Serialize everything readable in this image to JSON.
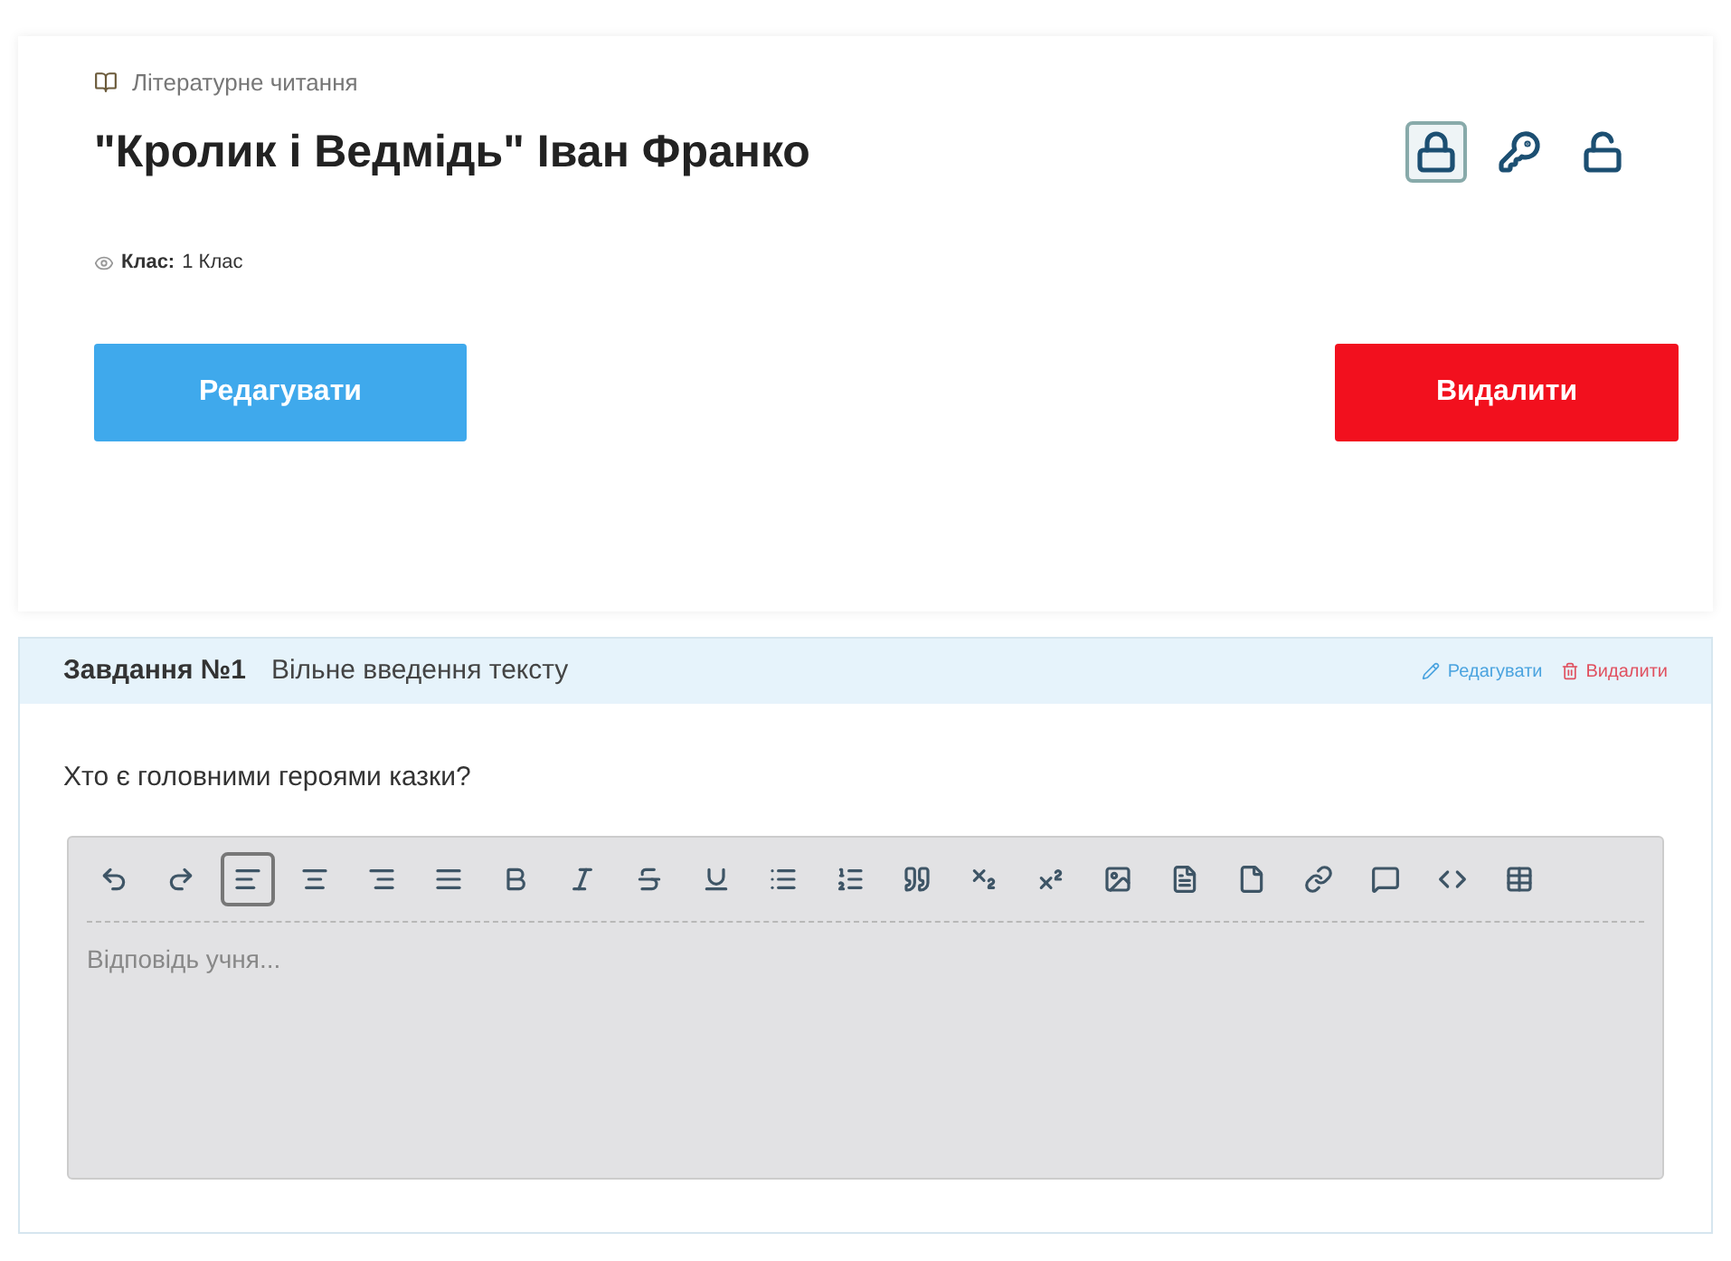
{
  "lesson": {
    "subject": "Літературне читання",
    "title": "\"Кролик і Ведмідь\" Іван Франко",
    "class_label": "Клас:",
    "class_value": "1 Клас"
  },
  "access_icons": [
    {
      "kind": "lock",
      "selected": true
    },
    {
      "kind": "key",
      "selected": false
    },
    {
      "kind": "unlock",
      "selected": false
    }
  ],
  "actions": {
    "edit": "Редагувати",
    "delete": "Видалити"
  },
  "task": {
    "number": "Завдання №1",
    "type": "Вільне введення тексту",
    "edit": "Редагувати",
    "delete": "Видалити",
    "question": "Хто є головними героями казки?",
    "editor": {
      "placeholder": "Відповідь учня...",
      "tools": [
        {
          "kind": "undo",
          "selected": false
        },
        {
          "kind": "redo",
          "selected": false
        },
        {
          "kind": "align-left",
          "selected": true
        },
        {
          "kind": "align-center",
          "selected": false
        },
        {
          "kind": "align-right",
          "selected": false
        },
        {
          "kind": "justify",
          "selected": false
        },
        {
          "kind": "bold",
          "selected": false
        },
        {
          "kind": "italic",
          "selected": false
        },
        {
          "kind": "strike",
          "selected": false
        },
        {
          "kind": "underline",
          "selected": false
        },
        {
          "kind": "bullets",
          "selected": false
        },
        {
          "kind": "numbers",
          "selected": false
        },
        {
          "kind": "quote",
          "selected": false
        },
        {
          "kind": "subscript",
          "selected": false
        },
        {
          "kind": "superscript",
          "selected": false
        },
        {
          "kind": "image",
          "selected": false
        },
        {
          "kind": "document",
          "selected": false
        },
        {
          "kind": "file",
          "selected": false
        },
        {
          "kind": "link",
          "selected": false
        },
        {
          "kind": "comment",
          "selected": false
        },
        {
          "kind": "code",
          "selected": false
        },
        {
          "kind": "table",
          "selected": false
        }
      ]
    }
  }
}
